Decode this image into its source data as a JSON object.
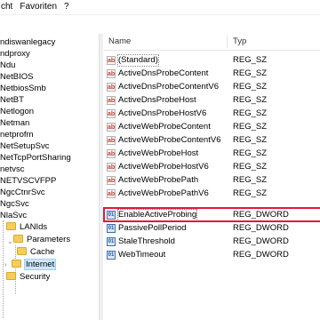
{
  "menu": [
    "cht",
    "Favoriten",
    "?"
  ],
  "tree": {
    "items": [
      "ndiswanlegacy",
      "ndproxy",
      "Ndu",
      "NetBIOS",
      "NetbiosSmb",
      "NetBT",
      "Netlogon",
      "Netman",
      "netprofm",
      "NetSetupSvc",
      "NetTcpPortSharing",
      "netvsc",
      "NETVSCVFPP",
      "NgcCtnrSvc",
      "NgcSvc",
      "NlaSvc"
    ],
    "sub": {
      "lanlds": "LANIds",
      "parameters": "Parameters",
      "cache": "Cache",
      "internet": "Internet",
      "security": "Security"
    }
  },
  "list": {
    "headers": {
      "name": "Name",
      "type": "Typ"
    },
    "rows": [
      {
        "name": "(Standard)",
        "type": "REG_SZ",
        "icon": "string-value-icon"
      },
      {
        "name": "ActiveDnsProbeContent",
        "type": "REG_SZ",
        "icon": "string-value-icon"
      },
      {
        "name": "ActiveDnsProbeContentV6",
        "type": "REG_SZ",
        "icon": "string-value-icon"
      },
      {
        "name": "ActiveDnsProbeHost",
        "type": "REG_SZ",
        "icon": "string-value-icon"
      },
      {
        "name": "ActiveDnsProbeHostV6",
        "type": "REG_SZ",
        "icon": "string-value-icon"
      },
      {
        "name": "ActiveWebProbeContent",
        "type": "REG_SZ",
        "icon": "string-value-icon"
      },
      {
        "name": "ActiveWebProbeContentV6",
        "type": "REG_SZ",
        "icon": "string-value-icon"
      },
      {
        "name": "ActiveWebProbeHost",
        "type": "REG_SZ",
        "icon": "string-value-icon"
      },
      {
        "name": "ActiveWebProbeHostV6",
        "type": "REG_SZ",
        "icon": "string-value-icon"
      },
      {
        "name": "ActiveWebProbePath",
        "type": "REG_SZ",
        "icon": "string-value-icon"
      },
      {
        "name": "ActiveWebProbePathV6",
        "type": "REG_SZ",
        "icon": "string-value-icon"
      },
      {
        "name": "EnableActiveProbing",
        "type": "REG_DWORD",
        "icon": "binary-value-icon"
      },
      {
        "name": "PassivePollPeriod",
        "type": "REG_DWORD",
        "icon": "binary-value-icon"
      },
      {
        "name": "StaleThreshold",
        "type": "REG_DWORD",
        "icon": "binary-value-icon"
      },
      {
        "name": "WebTimeout",
        "type": "REG_DWORD",
        "icon": "binary-value-icon"
      }
    ]
  },
  "colors": {
    "highlight": "#e0193a",
    "selection": "#cce8ff",
    "folder": "#f4cd5a"
  }
}
